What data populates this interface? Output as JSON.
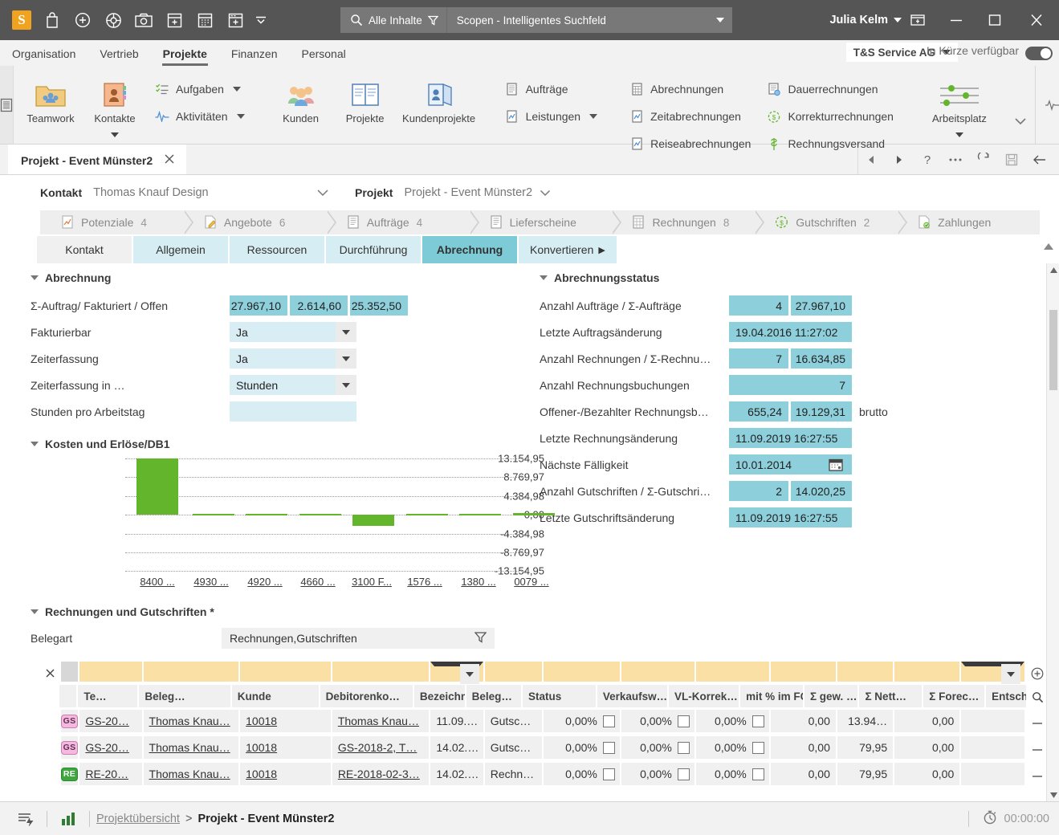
{
  "titlebar": {
    "logo_text": "S",
    "quick_icons": [
      "bag-icon",
      "plus-circle-icon",
      "lifebuoy-icon",
      "camera-icon",
      "calendar-add-icon",
      "calendar-grid-icon",
      "window-add-icon",
      "overflow-caret-icon"
    ],
    "search_scope": "Alle Inhalte",
    "search_placeholder": "Scopen - Intelligentes Suchfeld",
    "user_name": "Julia Kelm",
    "restore_icon": "restore-window-icon",
    "minimize_label": "—",
    "maximize_label": "▢",
    "close_label": "✕"
  },
  "menubar": {
    "items": [
      {
        "label": "Organisation",
        "active": false
      },
      {
        "label": "Vertrieb",
        "active": false
      },
      {
        "label": "Projekte",
        "active": true
      },
      {
        "label": "Finanzen",
        "active": false
      },
      {
        "label": "Personal",
        "active": false
      }
    ],
    "org_selector": "T&S Service AG",
    "availability_label": "In Kürze verfügbar"
  },
  "ribbon": {
    "groups": [
      {
        "big": [
          {
            "label": "Teamwork",
            "icon": "teamwork-folder-icon"
          },
          {
            "label": "Kontakte",
            "icon": "contacts-book-icon",
            "has_more": true
          }
        ],
        "small": [
          {
            "label": "Aufgaben",
            "icon": "tasks-icon",
            "dropdown": true
          },
          {
            "label": "Aktivitäten",
            "icon": "activities-icon",
            "dropdown": true
          }
        ]
      },
      {
        "big": [
          {
            "label": "Kunden",
            "icon": "customers-icon"
          },
          {
            "label": "Projekte",
            "icon": "projects-book-icon"
          },
          {
            "label": "Kundenprojekte",
            "icon": "customer-projects-icon"
          }
        ],
        "small": []
      },
      {
        "big": [],
        "small": [
          {
            "label": "Aufträge",
            "icon": "orders-icon",
            "dropdown": false
          },
          {
            "label": "Leistungen",
            "icon": "services-icon",
            "dropdown": true
          }
        ]
      },
      {
        "big": [],
        "small": [
          {
            "label": "Abrechnungen",
            "icon": "billing-icon",
            "dropdown": false
          },
          {
            "label": "Zeitabrechnungen",
            "icon": "time-billing-icon",
            "dropdown": false
          },
          {
            "label": "Reiseabrechnungen",
            "icon": "travel-billing-icon",
            "dropdown": false
          }
        ]
      },
      {
        "big": [],
        "small": [
          {
            "label": "Dauerrechnungen",
            "icon": "recurring-invoice-icon",
            "dropdown": false
          },
          {
            "label": "Korrekturrechnungen",
            "icon": "correction-invoice-icon",
            "dropdown": false
          },
          {
            "label": "Rechnungsversand",
            "icon": "invoice-dispatch-icon",
            "dropdown": false
          }
        ]
      },
      {
        "big": [
          {
            "label": "Arbeitsplatz",
            "icon": "workplace-sliders-icon",
            "has_more": true
          }
        ],
        "small": []
      }
    ]
  },
  "doctab": {
    "title": "Projekt - Event Münster2",
    "close_label": "✕",
    "tools": [
      "back-nav-icon",
      "forward-nav-icon",
      "help-icon",
      "more-icon",
      "refresh-icon",
      "save-icon",
      "exit-icon"
    ]
  },
  "context": {
    "kontakt_label": "Kontakt",
    "kontakt_value": "Thomas Knauf Design",
    "projekt_label": "Projekt",
    "projekt_value": "Projekt - Event Münster2"
  },
  "chips": [
    {
      "label": "Potenziale",
      "count": "4",
      "icon": "potential-icon"
    },
    {
      "label": "Angebote",
      "count": "6",
      "icon": "offer-icon"
    },
    {
      "label": "Aufträge",
      "count": "4",
      "icon": "order-icon"
    },
    {
      "label": "Lieferscheine",
      "count": "",
      "icon": "delivery-note-icon"
    },
    {
      "label": "Rechnungen",
      "count": "8",
      "icon": "invoice-icon"
    },
    {
      "label": "Gutschriften",
      "count": "2",
      "icon": "credit-note-icon"
    },
    {
      "label": "Zahlungen",
      "count": "",
      "icon": "payment-icon"
    }
  ],
  "subtabs": [
    {
      "label": "Kontakt",
      "style": "plain"
    },
    {
      "label": "Allgemein",
      "style": "normal"
    },
    {
      "label": "Ressourcen",
      "style": "normal"
    },
    {
      "label": "Durchführung",
      "style": "normal"
    },
    {
      "label": "Abrechnung",
      "style": "active"
    },
    {
      "label": "Konvertieren",
      "style": "normal",
      "arrow": "▶"
    }
  ],
  "abrechnung": {
    "title": "Abrechnung",
    "rows": [
      {
        "label": "Σ-Auftrag/ Fakturiert / Offen",
        "type": "triple",
        "values": [
          "27.967,10",
          "2.614,60",
          "25.352,50"
        ]
      },
      {
        "label": "Fakturierbar",
        "type": "select",
        "value": "Ja"
      },
      {
        "label": "Zeiterfassung",
        "type": "select",
        "value": "Ja"
      },
      {
        "label": "Zeiterfassung in …",
        "type": "select",
        "value": "Stunden"
      },
      {
        "label": "Stunden pro Arbeitstag",
        "type": "empty",
        "value": ""
      }
    ]
  },
  "abrechnungsstatus": {
    "title": "Abrechnungsstatus",
    "rows": [
      {
        "label": "Anzahl Aufträge / Σ-Aufträge",
        "type": "pair",
        "values": [
          "4",
          "27.967,10"
        ]
      },
      {
        "label": "Letzte Auftragsänderung",
        "type": "single",
        "values": [
          "19.04.2016 11:27:02"
        ]
      },
      {
        "label": "Anzahl Rechnungen / Σ-Rechnu…",
        "type": "pair",
        "values": [
          "7",
          "16.634,85"
        ]
      },
      {
        "label": "Anzahl Rechnungsbuchungen",
        "type": "singleright",
        "values": [
          "7"
        ]
      },
      {
        "label": "Offener-/Bezahlter Rechnungsb…",
        "type": "pair",
        "values": [
          "655,24",
          "19.129,31"
        ],
        "suffix": "brutto"
      },
      {
        "label": "Letzte Rechnungsänderung",
        "type": "single",
        "values": [
          "11.09.2019 16:27:55"
        ]
      },
      {
        "label": "Nächste Fälligkeit",
        "type": "date",
        "values": [
          "10.01.2014"
        ]
      },
      {
        "label": "Anzahl Gutschriften / Σ-Gutschri…",
        "type": "pair",
        "values": [
          "2",
          "14.020,25"
        ]
      },
      {
        "label": "Letzte Gutschriftsänderung",
        "type": "single",
        "values": [
          "11.09.2019 16:27:55"
        ]
      }
    ]
  },
  "chart_data": {
    "type": "bar",
    "title": "Kosten und Erlöse/DB1",
    "categories": [
      "8400 ...",
      "4930 ...",
      "4920 ...",
      "4660 ...",
      "3100 F...",
      "1576 ...",
      "1380 ...",
      "0079 ..."
    ],
    "values": [
      13154.95,
      40,
      40,
      40,
      -1600,
      40,
      40,
      60
    ],
    "ytick_labels": [
      "13.154,95",
      "8.769,97",
      "4.384,98",
      "0,00",
      "-4.384,98",
      "-8.769,97",
      "-13.154,95"
    ],
    "ytick_values": [
      13154.95,
      8769.97,
      4384.98,
      0,
      -4384.98,
      -8769.97,
      -13154.95
    ],
    "ylim": [
      -13154.95,
      13154.95
    ],
    "xlabel": "",
    "ylabel": "",
    "grid": true,
    "legend": "none",
    "bar_color": "#63b62b"
  },
  "table_section": {
    "title": "Rechnungen und Gutschriften *",
    "belegart_label": "Belegart",
    "belegart_value": "Rechnungen,Gutschriften",
    "filter_icon": "filter-icon",
    "add_icon": "add-column-icon",
    "search_icon": "search-icon",
    "clear_icon": "clear-filter-icon",
    "columns": [
      "Te…",
      "Beleg…",
      "Kunde",
      "Debitorenko…",
      "Bezeichnung …",
      "Beleg…",
      "Status",
      "Verkaufsw…",
      "VL-Korrek…",
      "mit % im FC",
      "Σ gew. …",
      "Σ Nett…",
      "Σ Forec…",
      "Entsch…"
    ],
    "rows": [
      {
        "badge": "GS",
        "badge_type": "gs",
        "beleg": "GS-20…",
        "kunde": "Thomas Knau…",
        "debitor": "10018",
        "bezeichnung": "Thomas Knau…",
        "belegdatum": "11.09.…",
        "status": "Gutsc…",
        "verkaufsw": "0,00%",
        "vlkorrek": "0,00%",
        "mitfc": "0,00%",
        "gew": "0,00",
        "netto": "13.94…",
        "forecast": "0,00",
        "entsch": ""
      },
      {
        "badge": "GS",
        "badge_type": "gs",
        "beleg": "GS-20…",
        "kunde": "Thomas Knau…",
        "debitor": "10018",
        "bezeichnung": "GS-2018-2, T…",
        "belegdatum": "14.02.…",
        "status": "Gutsc…",
        "verkaufsw": "0,00%",
        "vlkorrek": "0,00%",
        "mitfc": "0,00%",
        "gew": "0,00",
        "netto": "79,95",
        "forecast": "0,00",
        "entsch": ""
      },
      {
        "badge": "RE",
        "badge_type": "re",
        "beleg": "RE-20…",
        "kunde": "Thomas Knau…",
        "debitor": "10018",
        "bezeichnung": "RE-2018-02-3…",
        "belegdatum": "14.02.…",
        "status": "Rechn…",
        "verkaufsw": "0,00%",
        "vlkorrek": "0,00%",
        "mitfc": "0,00%",
        "gew": "0,00",
        "netto": "79,95",
        "forecast": "0,00",
        "entsch": ""
      }
    ]
  },
  "statusbar": {
    "breadcrumb_parent": "Projektübersicht",
    "breadcrumb_sep": ">",
    "breadcrumb_current": "Projekt - Event Münster2",
    "timer_value": "00:00:00"
  }
}
